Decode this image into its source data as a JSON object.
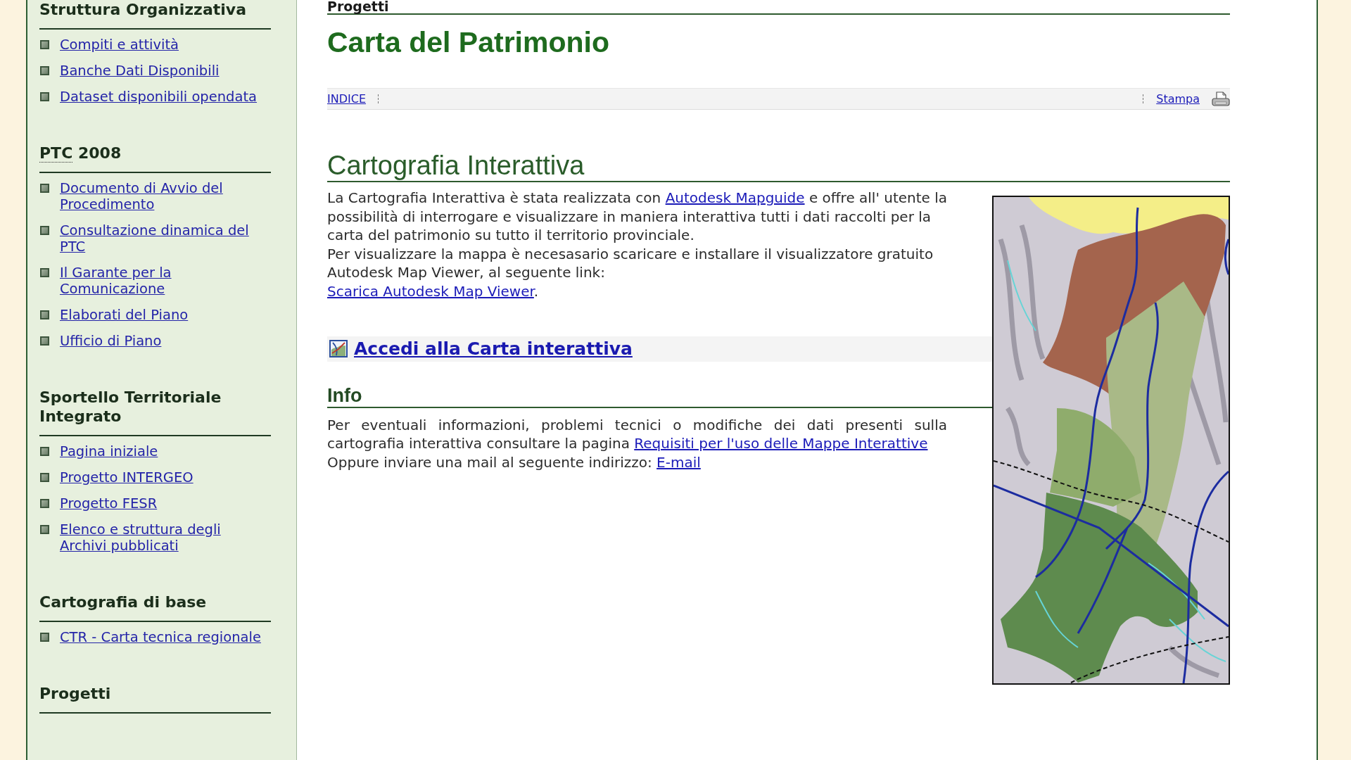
{
  "sidebar": {
    "sections": [
      {
        "title": "Struttura Organizzativa",
        "items": [
          "Compiti e attività",
          "Banche Dati Disponibili",
          "Dataset disponibili opendata"
        ]
      },
      {
        "abbr": "PTC",
        "title": "2008",
        "items": [
          "Documento di Avvio del Procedimento",
          "Consultazione dinamica del PTC",
          "Il Garante per la Comunicazione",
          "Elaborati del Piano",
          "Ufficio di Piano"
        ]
      },
      {
        "title": "Sportello Territoriale Integrato",
        "items": [
          "Pagina iniziale",
          "Progetto INTERGEO",
          "Progetto FESR",
          "Elenco e struttura degli Archivi pubblicati"
        ]
      },
      {
        "title": "Cartografia di base",
        "items": [
          "CTR - Carta tecnica regionale"
        ]
      },
      {
        "title": "Progetti"
      }
    ]
  },
  "main": {
    "breadcrumb": "Progetti",
    "title": "Carta del Patrimonio",
    "toolbar": {
      "index_link": "INDICE",
      "print_link": "Stampa"
    },
    "section": {
      "heading": "Cartografia Interattiva",
      "intro": {
        "before": "La Cartografia Interattiva è stata realizzata con",
        "link": "Autodesk Mapguide",
        "after": "e offre all' utente la possibilità di interrogare e visualizzare in maniera interattiva tutti i dati raccolti per la carta del patrimonio su tutto il territorio provinciale."
      },
      "download": {
        "text": "Per visualizzare la mappa è necesasario scaricare e installare il visualizzatore gratuito Autodesk Map Viewer, al seguente link:",
        "link": "Scarica Autodesk Map Viewer",
        "after": "."
      },
      "access_link": "Accedi alla Carta interattiva",
      "info": {
        "heading": "Info",
        "text": "Per eventuali informazioni, problemi tecnici o modifiche dei dati presenti sulla cartografia interattiva consultare la pagina",
        "link": "Requisiti per l'uso delle Mappe Interattive",
        "mail_text": "Oppure inviare una mail al seguente indirizzo:",
        "mail_link": "E-mail"
      }
    }
  }
}
